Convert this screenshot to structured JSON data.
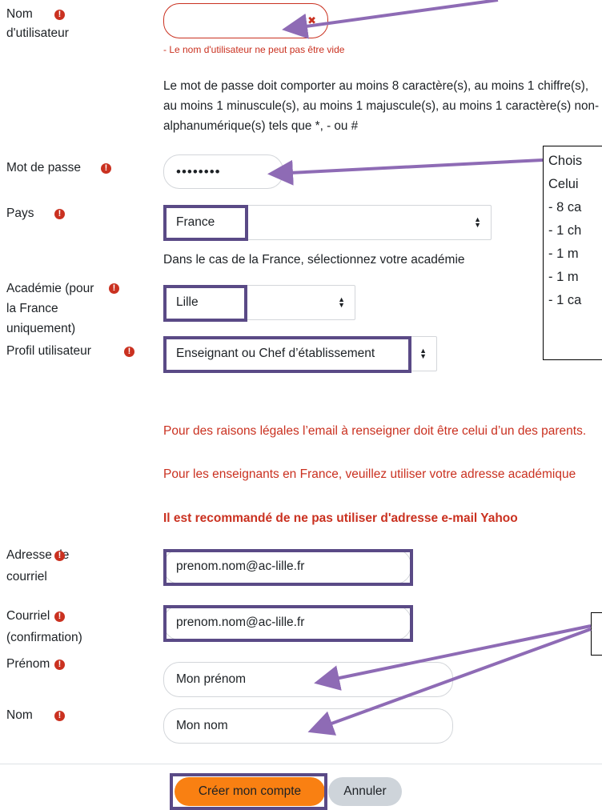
{
  "form": {
    "username": {
      "label": "Nom\nd'utilisateur",
      "value": "",
      "clear_glyph": "✖",
      "error": "- Le nom d'utilisateur ne peut pas être vide"
    },
    "password_rules": "Le mot de passe doit comporter au moins 8 caractère(s), au moins 1 chiffre(s), au moins 1 minuscule(s), au moins 1 majuscule(s), au moins 1 caractère(s) non-alphanumérique(s) tels que *, - ou #",
    "password": {
      "label": "Mot de passe",
      "value": "••••••••"
    },
    "country": {
      "label": "Pays",
      "value": "France",
      "hint": "Dans le cas de la France, sélectionnez votre académie"
    },
    "academy": {
      "label": "Académie (pour\nla France\nuniquement)",
      "value": "Lille"
    },
    "profile": {
      "label": "Profil utilisateur",
      "value": "Enseignant ou Chef d’établissement"
    },
    "notice": {
      "line1": "Pour des raisons légales l’email à renseigner doit être celui d’un des parents.",
      "line2": "Pour les enseignants en France, veuillez utiliser votre adresse académique",
      "line3": "Il est recommandé de ne pas utiliser d'adresse e-mail Yahoo"
    },
    "email": {
      "label": "Adresse de\ncourriel",
      "value": "prenom.nom@ac-lille.fr"
    },
    "email_confirm": {
      "label": "Courriel\n(confirmation)",
      "value": "prenom.nom@ac-lille.fr"
    },
    "firstname": {
      "label": "Prénom",
      "value": "Mon prénom"
    },
    "lastname": {
      "label": "Nom",
      "value": "Mon nom"
    },
    "required_glyph": "!",
    "submit_label": "Créer mon compte",
    "cancel_label": "Annuler"
  },
  "callout_password": {
    "lines": [
      "Chois",
      "Celui",
      "- 8 ca",
      "- 1 ch",
      "- 1 m",
      "- 1 m",
      "- 1 ca"
    ]
  },
  "colors": {
    "error": "#ca3120",
    "highlight": "#5a4a86",
    "arrow": "#8e6bb5",
    "primary_button": "#f98012",
    "secondary_button": "#ced4da"
  }
}
